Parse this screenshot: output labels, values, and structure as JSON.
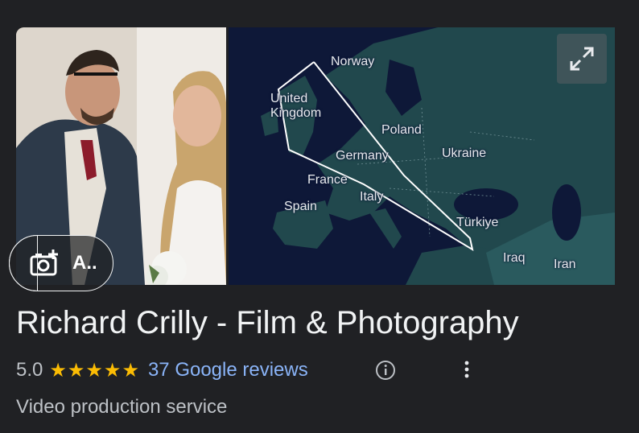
{
  "photo_button": {
    "label": "A.."
  },
  "map": {
    "labels": {
      "norway": "Norway",
      "uk": "United\nKingdom",
      "poland": "Poland",
      "germany": "Germany",
      "ukraine": "Ukraine",
      "france": "France",
      "italy": "Italy",
      "spain": "Spain",
      "turkiye": "Türkiye",
      "iraq": "Iraq",
      "iran": "Iran"
    }
  },
  "business": {
    "name": "Richard Crilly - Film & Photography",
    "rating": "5.0",
    "stars": "★★★★★",
    "star_count": 5,
    "reviews_link": "37 Google reviews",
    "category": "Video production service"
  },
  "colors": {
    "background": "#202124",
    "link": "#8ab4f8",
    "star": "#fbbc04"
  },
  "icons": [
    "add-photo-icon",
    "expand-icon",
    "info-icon",
    "more-vert-icon"
  ]
}
